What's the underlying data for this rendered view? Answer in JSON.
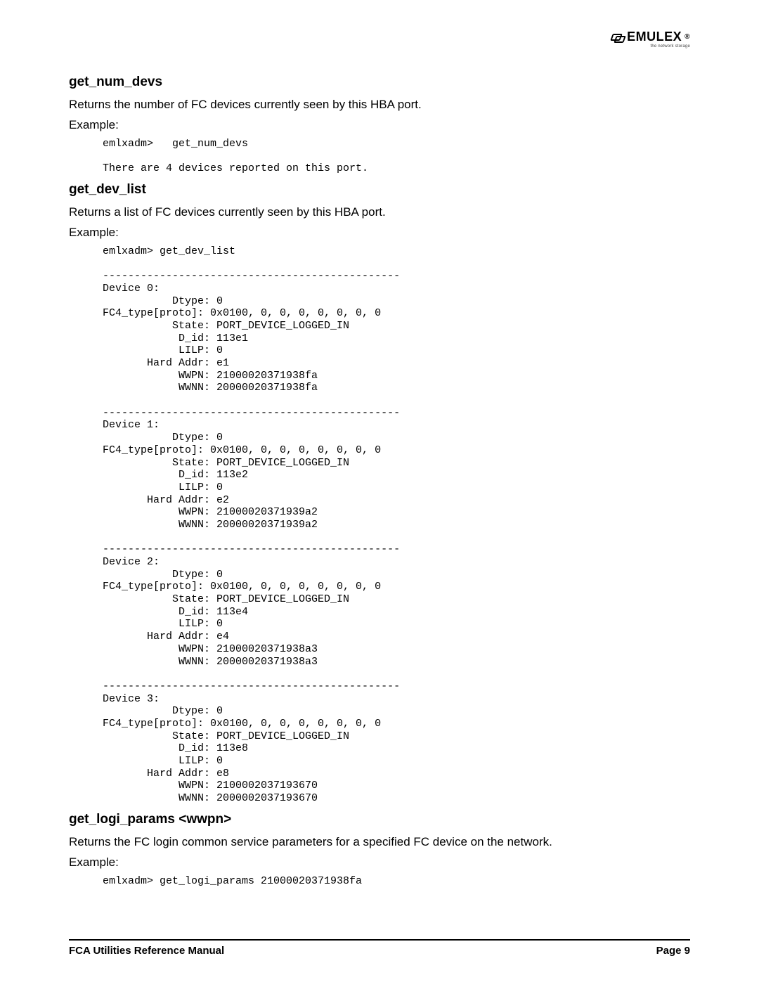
{
  "brand": {
    "name": "EMULEX",
    "tagline": "the network storage"
  },
  "sections": {
    "num_devs": {
      "heading": "get_num_devs",
      "desc": "Returns the number of FC devices currently seen by this HBA port.",
      "example_label": "Example:",
      "code": "emlxadm>   get_num_devs\n\nThere are 4 devices reported on this port."
    },
    "dev_list": {
      "heading": "get_dev_list",
      "desc": "Returns a list of FC devices currently seen by this HBA port.",
      "example_label": "Example:",
      "code": "emlxadm> get_dev_list\n\n-----------------------------------------------\nDevice 0:\n           Dtype: 0\nFC4_type[proto]: 0x0100, 0, 0, 0, 0, 0, 0, 0\n           State: PORT_DEVICE_LOGGED_IN\n            D_id: 113e1\n            LILP: 0\n       Hard Addr: e1\n            WWPN: 21000020371938fa\n            WWNN: 20000020371938fa\n\n-----------------------------------------------\nDevice 1:\n           Dtype: 0\nFC4_type[proto]: 0x0100, 0, 0, 0, 0, 0, 0, 0\n           State: PORT_DEVICE_LOGGED_IN\n            D_id: 113e2\n            LILP: 0\n       Hard Addr: e2\n            WWPN: 21000020371939a2\n            WWNN: 20000020371939a2\n\n-----------------------------------------------\nDevice 2:\n           Dtype: 0\nFC4_type[proto]: 0x0100, 0, 0, 0, 0, 0, 0, 0\n           State: PORT_DEVICE_LOGGED_IN\n            D_id: 113e4\n            LILP: 0\n       Hard Addr: e4\n            WWPN: 21000020371938a3\n            WWNN: 20000020371938a3\n\n-----------------------------------------------\nDevice 3:\n           Dtype: 0\nFC4_type[proto]: 0x0100, 0, 0, 0, 0, 0, 0, 0\n           State: PORT_DEVICE_LOGGED_IN\n            D_id: 113e8\n            LILP: 0\n       Hard Addr: e8\n            WWPN: 2100002037193670\n            WWNN: 2000002037193670"
    },
    "logi_params": {
      "heading": "get_logi_params <wwpn>",
      "desc": "Returns the FC login common service parameters for a specified FC device on the network.",
      "example_label": "Example:",
      "code": "emlxadm> get_logi_params 21000020371938fa"
    }
  },
  "footer": {
    "left": "FCA Utilities Reference Manual",
    "right": "Page 9"
  }
}
